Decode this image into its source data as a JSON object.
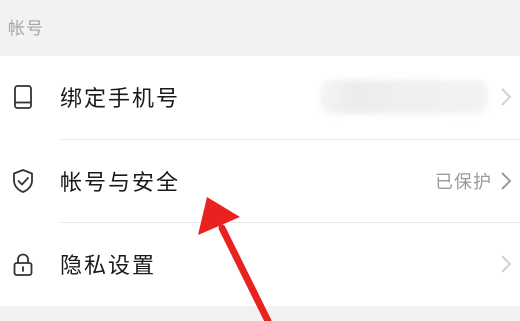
{
  "section": {
    "title": "帐号"
  },
  "rows": [
    {
      "label": "绑定手机号",
      "value": "",
      "icon": "phone-icon"
    },
    {
      "label": "帐号与安全",
      "value": "已保护",
      "icon": "shield-check-icon"
    },
    {
      "label": "隐私设置",
      "value": "",
      "icon": "lock-icon"
    }
  ],
  "colors": {
    "background": "#f2f2f2",
    "row_background": "#ffffff",
    "label": "#1a1a1a",
    "secondary": "#9a9a9a",
    "annotation_arrow": "#e8231f"
  }
}
